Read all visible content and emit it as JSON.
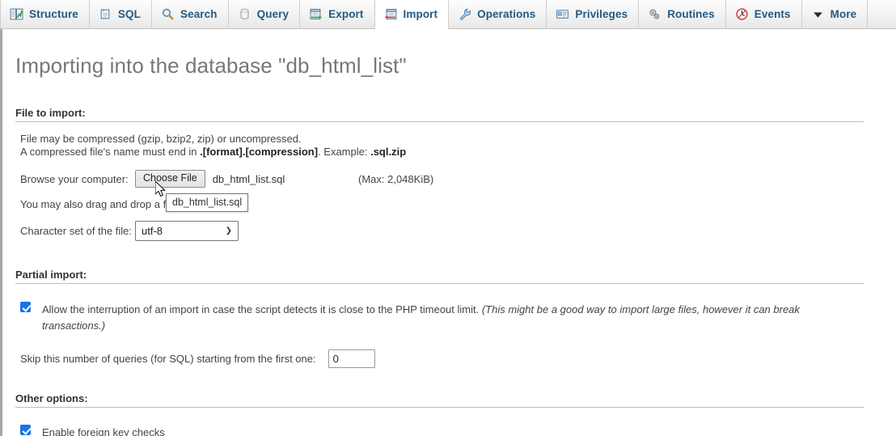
{
  "tabs": [
    {
      "label": "Structure",
      "icon": "structure-icon",
      "active": false
    },
    {
      "label": "SQL",
      "icon": "sql-icon",
      "active": false
    },
    {
      "label": "Search",
      "icon": "search-icon",
      "active": false
    },
    {
      "label": "Query",
      "icon": "query-icon",
      "active": false
    },
    {
      "label": "Export",
      "icon": "export-icon",
      "active": false
    },
    {
      "label": "Import",
      "icon": "import-icon",
      "active": true
    },
    {
      "label": "Operations",
      "icon": "wrench-icon",
      "active": false
    },
    {
      "label": "Privileges",
      "icon": "privileges-icon",
      "active": false
    },
    {
      "label": "Routines",
      "icon": "routines-icon",
      "active": false
    },
    {
      "label": "Events",
      "icon": "clock-icon",
      "active": false
    },
    {
      "label": "More",
      "icon": "chevron-down-icon",
      "active": false
    }
  ],
  "page": {
    "title": "Importing into the database \"db_html_list\""
  },
  "file_to_import": {
    "legend": "File to import:",
    "note_line_1": "File may be compressed (gzip, bzip2, zip) or uncompressed.",
    "note_line_2_pre": "A compressed file's name must end in ",
    "note_line_2_format": ".[format].[compression]",
    "note_line_2_mid": ". Example: ",
    "note_line_2_example": ".sql.zip",
    "browse_label": "Browse your computer:",
    "choose_file_button": "Choose File",
    "selected_file_name": "db_html_list.sql",
    "max_size": "(Max: 2,048KiB)",
    "drag_drop_text": "You may also drag and drop a f",
    "charset_label": "Character set of the file:",
    "charset_value": "utf-8",
    "charset_options": [
      "utf-8"
    ],
    "tooltip_text": "db_html_list.sql"
  },
  "partial_import": {
    "legend": "Partial import:",
    "allow_interruption_checked": true,
    "allow_interruption_text": "Allow the interruption of an import in case the script detects it is close to the PHP timeout limit. ",
    "allow_interruption_italic": "(This might be a good way to import large files, however it can break transactions.)",
    "skip_label": "Skip this number of queries (for SQL) starting from the first one:",
    "skip_value": "0"
  },
  "other_options": {
    "legend": "Other options:",
    "foreign_key_checked": true,
    "foreign_key_label": "Enable foreign key checks"
  },
  "colors": {
    "tab_text": "#235a81",
    "title_text": "#777777",
    "checkbox_blue": "#1a73e8",
    "rule": "#bdbdbd"
  }
}
